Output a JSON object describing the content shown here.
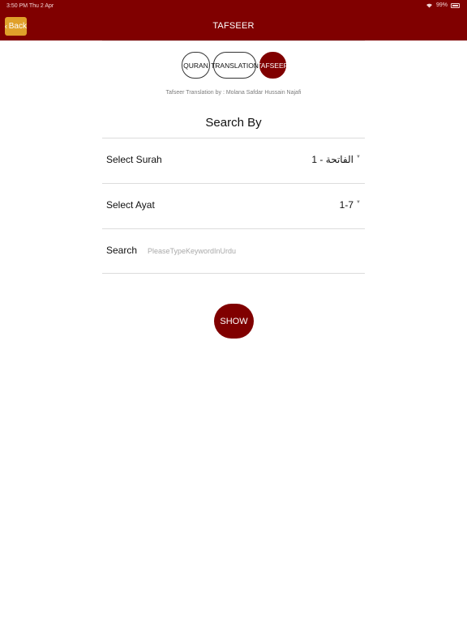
{
  "status_bar": {
    "time_date": "3:50 PM  Thu 2 Apr",
    "battery": "99%"
  },
  "nav": {
    "back_label": "Back",
    "title": "TAFSEER"
  },
  "segments": [
    {
      "label": "QURAN",
      "active": false
    },
    {
      "label": "TRANSLATION",
      "active": false
    },
    {
      "label": "TAFSEER",
      "active": true
    }
  ],
  "credit": "Tafseer Translation by : Molana Safdar Hussain Najafi",
  "search_by_title": "Search By",
  "form": {
    "surah": {
      "label": "Select Surah",
      "value": "الفاتحة - 1"
    },
    "ayat": {
      "label": "Select Ayat",
      "value": "1-7"
    },
    "search": {
      "label": "Search",
      "placeholder": "PleaseTypeKeywordInUrdu",
      "value": ""
    }
  },
  "show_button": "SHOW",
  "colors": {
    "primary": "#800000",
    "back_button": "#e0a02a"
  },
  "icons": {
    "back": "chevron-left-icon",
    "dropdown": "dropdown-arrow-icon",
    "wifi": "wifi-icon",
    "battery": "battery-icon"
  }
}
